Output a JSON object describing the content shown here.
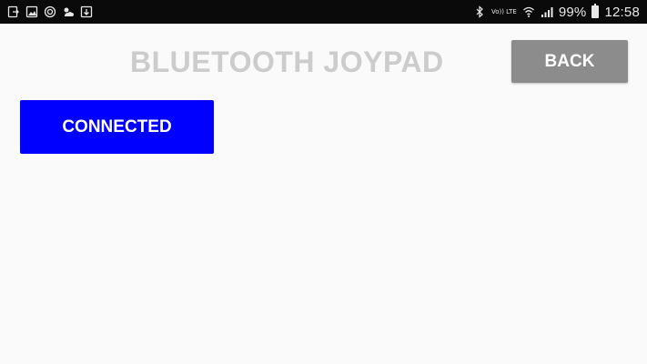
{
  "status_bar": {
    "left_icons": [
      "screen-mirror-icon",
      "image-icon",
      "sync-icon",
      "weather-icon",
      "download-icon"
    ],
    "right_icons": [
      "bluetooth-icon",
      "wifi-icon",
      "signal-icon"
    ],
    "volte_label": "Vo)) LTE",
    "battery_percent": "99%",
    "battery_level": 0.99,
    "time": "12:58"
  },
  "header": {
    "title": "BLUETOOTH JOYPAD",
    "back_label": "BACK"
  },
  "main": {
    "connection_button_label": "CONNECTED"
  },
  "colors": {
    "background": "#fafafa",
    "status_bar": "#0a0a0a",
    "title": "#cccccc",
    "back_button": "#8c8c8c",
    "connection_button": "#0000ff"
  }
}
